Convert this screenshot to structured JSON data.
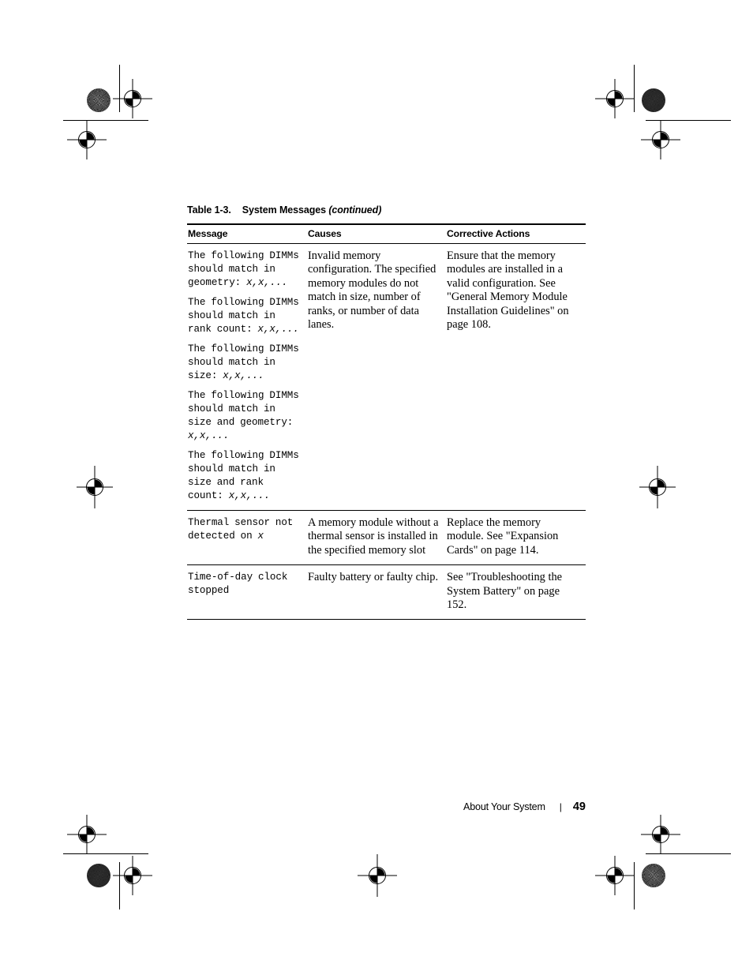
{
  "document": {
    "table_title": {
      "number": "Table 1-3.",
      "name": "System Messages",
      "continued": "(continued)"
    },
    "columns": [
      "Message",
      "Causes",
      "Corrective Actions"
    ],
    "rows": [
      {
        "message_blocks": [
          {
            "code": "The following DIMMs should match in geometry: ",
            "var": "x,x,..."
          },
          {
            "code": "The following DIMMs should match in rank count: ",
            "var": "x,x,..."
          },
          {
            "code": "The following DIMMs should match in size: ",
            "var": "x,x,..."
          },
          {
            "code": "The following DIMMs should match in size and geometry: ",
            "var": "x,x,..."
          },
          {
            "code": "The following DIMMs should match in size and rank count: ",
            "var": "x,x,..."
          }
        ],
        "cause": "Invalid memory configuration. The specified memory modules do not match in size, number of ranks, or number of data lanes.",
        "action": "Ensure that the memory modules are installed in a valid configuration. See \"General Memory Module Installation Guidelines\" on page 108."
      },
      {
        "message_blocks": [
          {
            "code": "Thermal sensor not detected on ",
            "var": "x"
          }
        ],
        "cause": "A memory module without a thermal sensor is installed in the specified memory slot",
        "action": "Replace the memory module. See \"Expansion Cards\" on page 114."
      },
      {
        "message_blocks": [
          {
            "code": "Time-of-day clock stopped",
            "var": ""
          }
        ],
        "cause": "Faulty battery or faulty chip.",
        "action": "See \"Troubleshooting the System Battery\" on page 152."
      }
    ],
    "footer": {
      "section": "About Your System",
      "separator": "|",
      "page_number": "49"
    }
  }
}
